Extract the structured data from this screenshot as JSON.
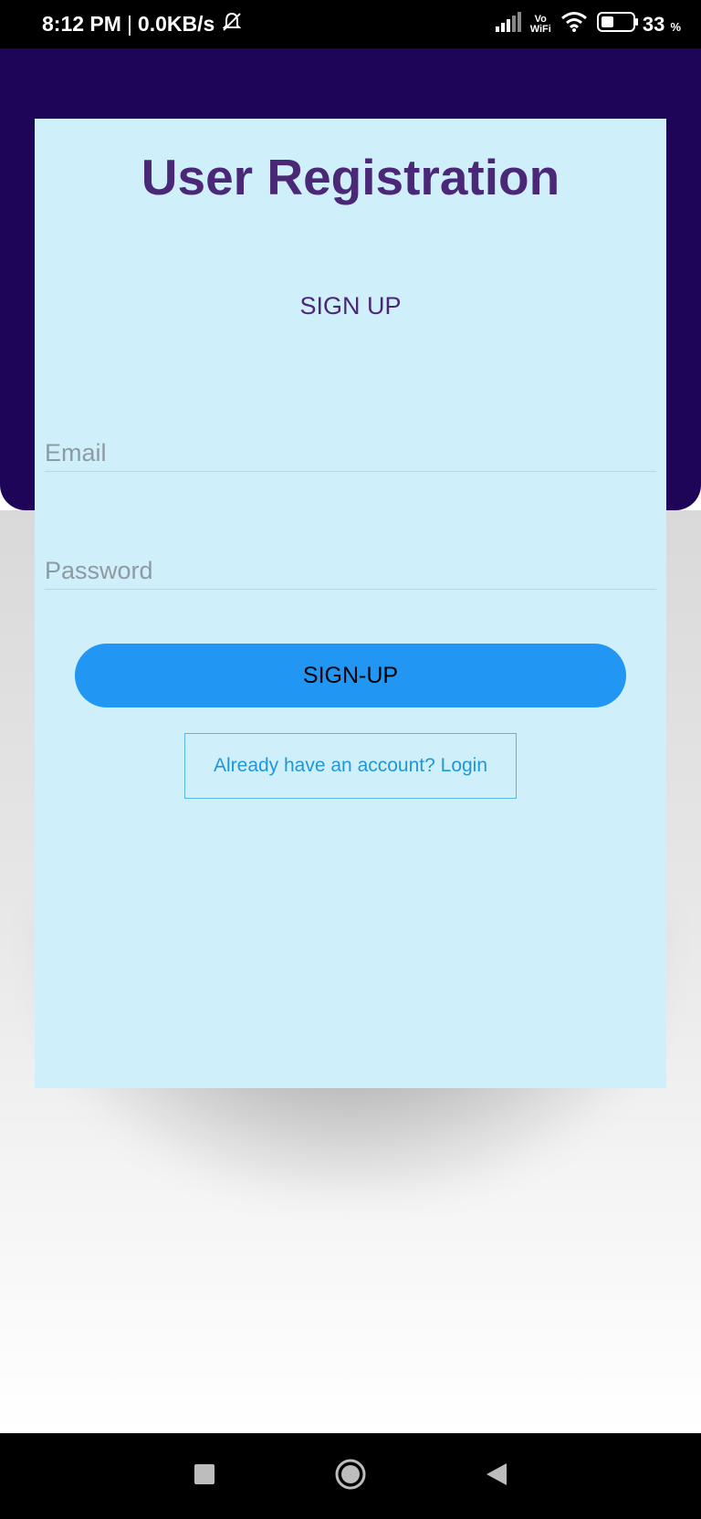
{
  "status_bar": {
    "time": "8:12 PM",
    "separator": "|",
    "network_speed": "0.0KB/s",
    "vowifi_top": "Vo",
    "vowifi_bottom": "WiFi",
    "battery": "33",
    "battery_unit": "%"
  },
  "form": {
    "title": "User Registration",
    "subtitle": "SIGN UP",
    "email_placeholder": "Email",
    "password_placeholder": "Password",
    "signup_label": "SIGN-UP",
    "login_link_label": "Already have an account? Login"
  },
  "nav": {
    "recents_icon": "square-icon",
    "home_icon": "circle-icon",
    "back_icon": "triangle-back-icon"
  },
  "colors": {
    "header": "#1e0558",
    "card": "#cff0fb",
    "title": "#4b2877",
    "button": "#2196f3",
    "link": "#2196d8"
  }
}
